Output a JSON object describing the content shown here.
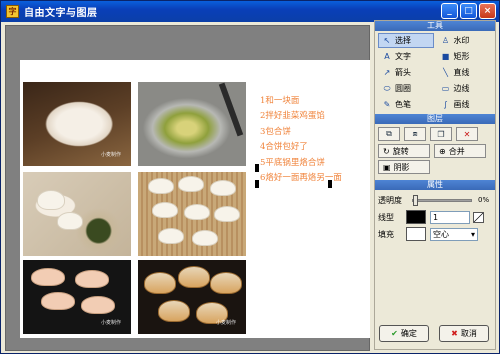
{
  "window": {
    "title": "自由文字与图层",
    "controls": {
      "minimize": "_",
      "maximize": "□",
      "close": "×"
    }
  },
  "canvas": {
    "step_lines": [
      "1和一块面",
      "2拌好韭菜鸡蛋馅",
      "3包合饼",
      "4合饼包好了",
      "5平底锅里烙合饼",
      "6烙好一面再烙另一面"
    ],
    "photo_watermark": "小麦制作"
  },
  "panel": {
    "tools_header": "工具",
    "tools": [
      {
        "label": "选择",
        "icon": "select-arrow-icon",
        "active": true
      },
      {
        "label": "水印",
        "icon": "watermark-icon",
        "active": false
      },
      {
        "label": "文字",
        "icon": "text-icon",
        "active": false
      },
      {
        "label": "矩形",
        "icon": "rectangle-icon",
        "active": false
      },
      {
        "label": "箭头",
        "icon": "arrow-icon",
        "active": false
      },
      {
        "label": "直线",
        "icon": "line-icon",
        "active": false
      },
      {
        "label": "圆圈",
        "icon": "ellipse-icon",
        "active": false
      },
      {
        "label": "边线",
        "icon": "border-icon",
        "active": false
      },
      {
        "label": "色笔",
        "icon": "pen-icon",
        "active": false
      },
      {
        "label": "画线",
        "icon": "freehand-icon",
        "active": false
      }
    ],
    "layers_header": "图层",
    "layer_actions": {
      "rotate": "旋转",
      "merge": "合并",
      "shadow": "阴影"
    },
    "props_header": "属性",
    "props": {
      "transparency_label": "透明度",
      "transparency_value": "0%",
      "transparency_level": 0,
      "line_label": "线型",
      "line_width": "1",
      "fill_label": "填充",
      "fill_option": "空心"
    },
    "ok_label": "确定",
    "cancel_label": "取消"
  }
}
